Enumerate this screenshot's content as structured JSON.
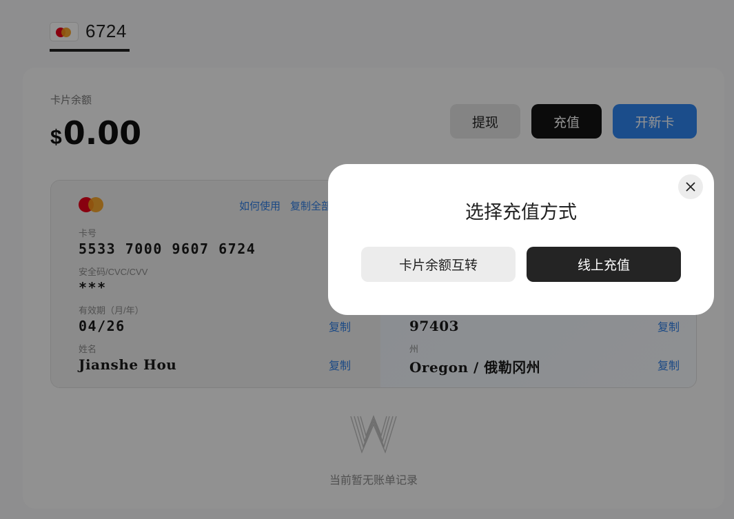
{
  "tab": {
    "card_last4": "6724"
  },
  "balance": {
    "label": "卡片余额",
    "currency": "$",
    "amount": "0.00"
  },
  "actions": {
    "withdraw": "提现",
    "topup": "充值",
    "new_card": "开新卡"
  },
  "card": {
    "how_to_use": "如何使用",
    "copy_all": "复制全部",
    "number_label": "卡号",
    "number": "5533 7000 9607 6724",
    "cvc_label": "安全码/CVC/CVV",
    "cvc": "***",
    "expiry_label": "有效期（月/年）",
    "expiry": "04/26",
    "name_label": "姓名",
    "name": "Jianshe Hou",
    "zip": "97403",
    "state_label": "州",
    "state": "Oregon / 俄勒冈州",
    "copy": "复制"
  },
  "empty_state": {
    "text": "当前暂无账单记录"
  },
  "modal": {
    "title": "选择充值方式",
    "option_transfer": "卡片余额互转",
    "option_online": "线上充值"
  },
  "colors": {
    "accent_blue": "#2f86f0",
    "dark": "#141414",
    "link": "#2f7fe6"
  }
}
